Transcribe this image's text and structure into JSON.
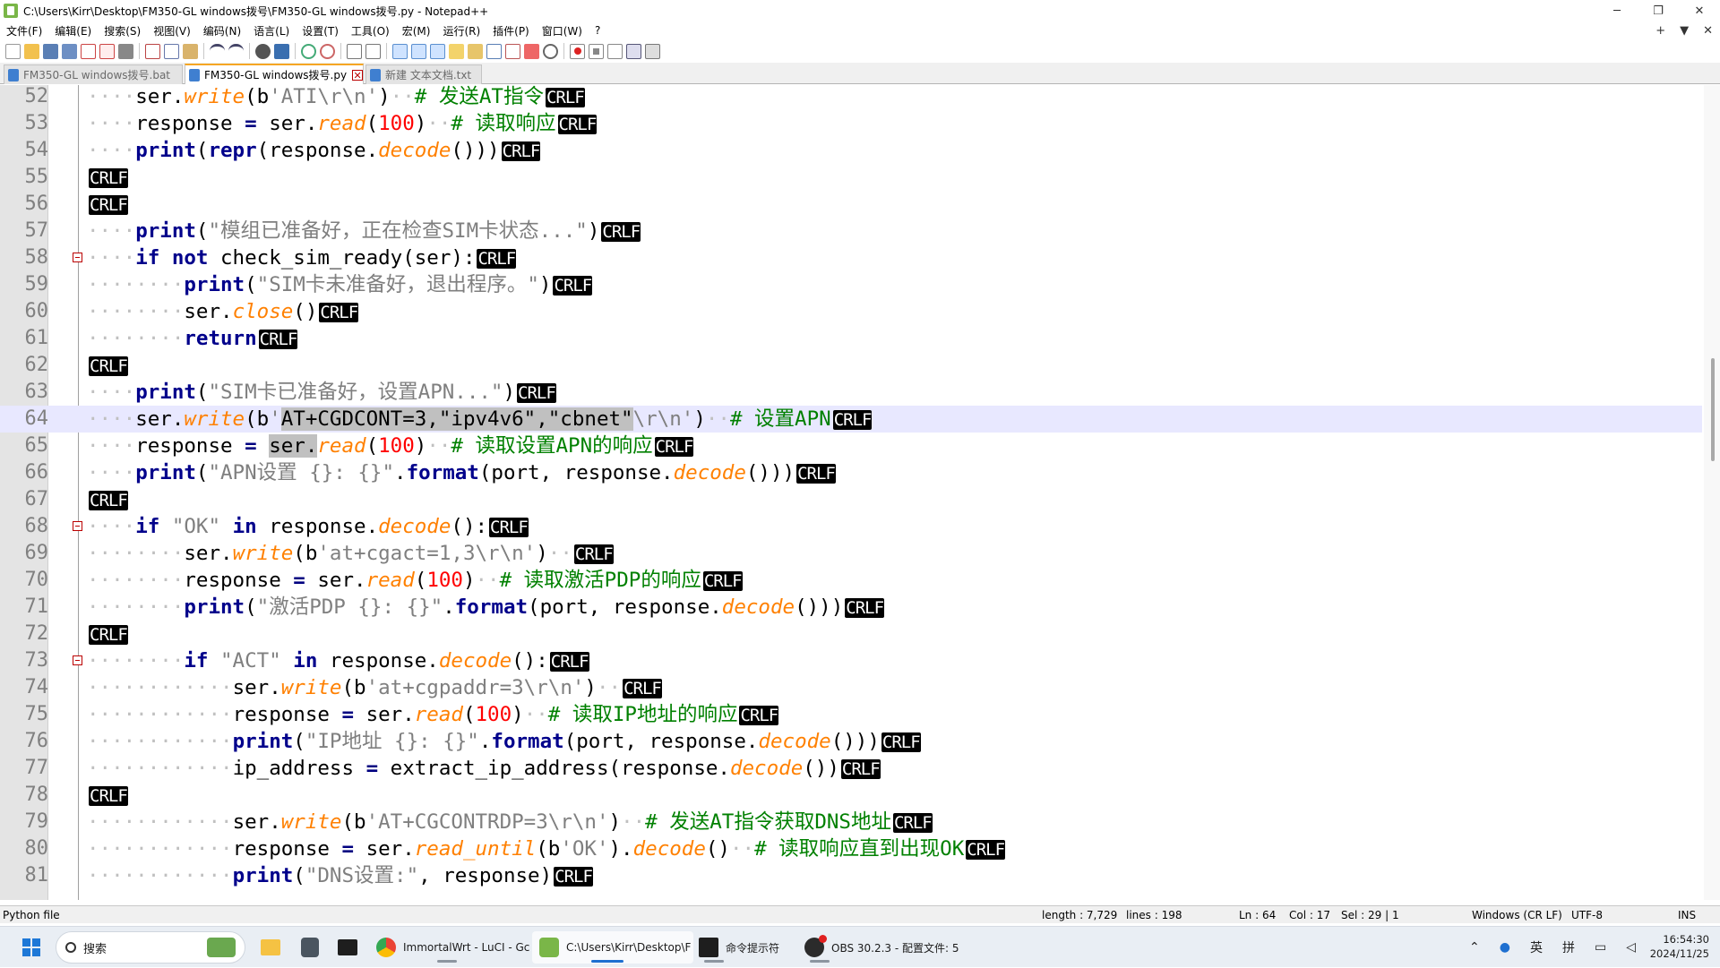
{
  "window": {
    "title": "C:\\Users\\Kirr\\Desktop\\FM350-GL windows拨号\\FM350-GL windows拨号.py - Notepad++",
    "controls": [
      "─",
      "❐",
      "✕"
    ]
  },
  "menu": {
    "items": [
      "文件(F)",
      "编辑(E)",
      "搜索(S)",
      "视图(V)",
      "编码(N)",
      "语言(L)",
      "设置(T)",
      "工具(O)",
      "宏(M)",
      "运行(R)",
      "插件(P)",
      "窗口(W)",
      "?"
    ],
    "right": [
      "+",
      "▼",
      "✕"
    ]
  },
  "tabs": [
    {
      "label": "FM350-GL windows拨号.bat",
      "active": false,
      "color": "#3f7fd0"
    },
    {
      "label": "FM350-GL windows拨号.py",
      "active": true,
      "color": "#3f7fd0"
    },
    {
      "label": "新建 文本文档.txt",
      "active": false,
      "color": "#3f7fd0"
    }
  ],
  "eol_marker": "CRLF",
  "code_lines": [
    {
      "n": "52",
      "ind": 1,
      "t": [
        [
          "fn",
          "ser."
        ],
        [
          "mth",
          "write"
        ],
        [
          "fn",
          "(b"
        ],
        [
          "str",
          "'ATI\\r\\n'"
        ],
        [
          "fn",
          ")"
        ],
        [
          "ws",
          "··"
        ],
        [
          "cmt",
          "# 发送AT指令"
        ]
      ]
    },
    {
      "n": "53",
      "ind": 1,
      "t": [
        [
          "fn",
          "response "
        ],
        [
          "op",
          "="
        ],
        [
          "fn",
          " ser."
        ],
        [
          "mth",
          "read"
        ],
        [
          "fn",
          "("
        ],
        [
          "num",
          "100"
        ],
        [
          "fn",
          ")"
        ],
        [
          "ws",
          "··"
        ],
        [
          "cmt",
          "# 读取响应"
        ]
      ]
    },
    {
      "n": "54",
      "ind": 1,
      "t": [
        [
          "kw",
          "print"
        ],
        [
          "fn",
          "("
        ],
        [
          "kw",
          "repr"
        ],
        [
          "fn",
          "(response."
        ],
        [
          "mth",
          "decode"
        ],
        [
          "fn",
          "()))"
        ]
      ]
    },
    {
      "n": "55",
      "ind": 0,
      "t": []
    },
    {
      "n": "56",
      "ind": 0,
      "t": []
    },
    {
      "n": "57",
      "ind": 1,
      "t": [
        [
          "kw",
          "print"
        ],
        [
          "fn",
          "("
        ],
        [
          "str",
          "\"模组已准备好，正在检查SIM卡状态...\""
        ],
        [
          "fn",
          ")"
        ]
      ]
    },
    {
      "n": "58",
      "ind": 1,
      "fold": true,
      "t": [
        [
          "kw",
          "if"
        ],
        [
          "fn",
          " "
        ],
        [
          "kw",
          "not"
        ],
        [
          "fn",
          " check_sim_ready(ser):"
        ]
      ]
    },
    {
      "n": "59",
      "ind": 2,
      "t": [
        [
          "kw",
          "print"
        ],
        [
          "fn",
          "("
        ],
        [
          "str",
          "\"SIM卡未准备好，退出程序。\""
        ],
        [
          "fn",
          ")"
        ]
      ]
    },
    {
      "n": "60",
      "ind": 2,
      "t": [
        [
          "fn",
          "ser."
        ],
        [
          "mth",
          "close"
        ],
        [
          "fn",
          "()"
        ]
      ]
    },
    {
      "n": "61",
      "ind": 2,
      "t": [
        [
          "kw",
          "return"
        ]
      ]
    },
    {
      "n": "62",
      "ind": 0,
      "t": []
    },
    {
      "n": "63",
      "ind": 1,
      "t": [
        [
          "kw",
          "print"
        ],
        [
          "fn",
          "("
        ],
        [
          "str",
          "\"SIM卡已准备好，设置APN...\""
        ],
        [
          "fn",
          ")"
        ]
      ]
    },
    {
      "n": "64",
      "ind": 1,
      "cur": true,
      "t": [
        [
          "fn",
          "ser."
        ],
        [
          "mth",
          "write"
        ],
        [
          "fn",
          "(b"
        ],
        [
          "str",
          "'"
        ],
        [
          "sel",
          "AT+CGDCONT=3,\"ipv4v6\",\"cbnet\""
        ],
        [
          "str",
          "\\r\\n'"
        ],
        [
          "fn",
          ")"
        ],
        [
          "ws",
          "··"
        ],
        [
          "cmt",
          "# 设置APN"
        ]
      ]
    },
    {
      "n": "65",
      "ind": 1,
      "t": [
        [
          "fn",
          "response "
        ],
        [
          "op",
          "="
        ],
        [
          "fn",
          " "
        ],
        [
          "sel",
          "ser."
        ],
        [
          "mth",
          "read"
        ],
        [
          "fn",
          "("
        ],
        [
          "num",
          "100"
        ],
        [
          "fn",
          ")"
        ],
        [
          "ws",
          "··"
        ],
        [
          "cmt",
          "# 读取设置APN的响应"
        ]
      ]
    },
    {
      "n": "66",
      "ind": 1,
      "t": [
        [
          "kw",
          "print"
        ],
        [
          "fn",
          "("
        ],
        [
          "str",
          "\"APN设置 {}: {}\""
        ],
        [
          "fn",
          "."
        ],
        [
          "kw",
          "format"
        ],
        [
          "fn",
          "(port, response."
        ],
        [
          "mth",
          "decode"
        ],
        [
          "fn",
          "()))"
        ]
      ]
    },
    {
      "n": "67",
      "ind": 0,
      "t": []
    },
    {
      "n": "68",
      "ind": 1,
      "fold": true,
      "t": [
        [
          "kw",
          "if"
        ],
        [
          "fn",
          " "
        ],
        [
          "str",
          "\"OK\""
        ],
        [
          "fn",
          " "
        ],
        [
          "kw",
          "in"
        ],
        [
          "fn",
          " response."
        ],
        [
          "mth",
          "decode"
        ],
        [
          "fn",
          "():"
        ]
      ]
    },
    {
      "n": "69",
      "ind": 2,
      "t": [
        [
          "fn",
          "ser."
        ],
        [
          "mth",
          "write"
        ],
        [
          "fn",
          "(b"
        ],
        [
          "str",
          "'at+cgact=1,3\\r\\n'"
        ],
        [
          "fn",
          ")"
        ],
        [
          "ws",
          "··"
        ]
      ]
    },
    {
      "n": "70",
      "ind": 2,
      "t": [
        [
          "fn",
          "response "
        ],
        [
          "op",
          "="
        ],
        [
          "fn",
          " ser."
        ],
        [
          "mth",
          "read"
        ],
        [
          "fn",
          "("
        ],
        [
          "num",
          "100"
        ],
        [
          "fn",
          ")"
        ],
        [
          "ws",
          "··"
        ],
        [
          "cmt",
          "# 读取激活PDP的响应"
        ]
      ]
    },
    {
      "n": "71",
      "ind": 2,
      "t": [
        [
          "kw",
          "print"
        ],
        [
          "fn",
          "("
        ],
        [
          "str",
          "\"激活PDP {}: {}\""
        ],
        [
          "fn",
          "."
        ],
        [
          "kw",
          "format"
        ],
        [
          "fn",
          "(port, response."
        ],
        [
          "mth",
          "decode"
        ],
        [
          "fn",
          "()))"
        ]
      ]
    },
    {
      "n": "72",
      "ind": 0,
      "t": []
    },
    {
      "n": "73",
      "ind": 2,
      "fold": true,
      "t": [
        [
          "kw",
          "if"
        ],
        [
          "fn",
          " "
        ],
        [
          "str",
          "\"ACT\""
        ],
        [
          "fn",
          " "
        ],
        [
          "kw",
          "in"
        ],
        [
          "fn",
          " response."
        ],
        [
          "mth",
          "decode"
        ],
        [
          "fn",
          "():"
        ]
      ]
    },
    {
      "n": "74",
      "ind": 3,
      "t": [
        [
          "fn",
          "ser."
        ],
        [
          "mth",
          "write"
        ],
        [
          "fn",
          "(b"
        ],
        [
          "str",
          "'at+cgpaddr=3\\r\\n'"
        ],
        [
          "fn",
          ")"
        ],
        [
          "ws",
          "··"
        ]
      ]
    },
    {
      "n": "75",
      "ind": 3,
      "t": [
        [
          "fn",
          "response "
        ],
        [
          "op",
          "="
        ],
        [
          "fn",
          " ser."
        ],
        [
          "mth",
          "read"
        ],
        [
          "fn",
          "("
        ],
        [
          "num",
          "100"
        ],
        [
          "fn",
          ")"
        ],
        [
          "ws",
          "··"
        ],
        [
          "cmt",
          "# 读取IP地址的响应"
        ]
      ]
    },
    {
      "n": "76",
      "ind": 3,
      "t": [
        [
          "kw",
          "print"
        ],
        [
          "fn",
          "("
        ],
        [
          "str",
          "\"IP地址 {}: {}\""
        ],
        [
          "fn",
          "."
        ],
        [
          "kw",
          "format"
        ],
        [
          "fn",
          "(port, response."
        ],
        [
          "mth",
          "decode"
        ],
        [
          "fn",
          "()))"
        ]
      ]
    },
    {
      "n": "77",
      "ind": 3,
      "t": [
        [
          "fn",
          "ip_address "
        ],
        [
          "op",
          "="
        ],
        [
          "fn",
          " extract_ip_address(response."
        ],
        [
          "mth",
          "decode"
        ],
        [
          "fn",
          "())"
        ]
      ]
    },
    {
      "n": "78",
      "ind": 0,
      "t": []
    },
    {
      "n": "79",
      "ind": 3,
      "t": [
        [
          "fn",
          "ser."
        ],
        [
          "mth",
          "write"
        ],
        [
          "fn",
          "(b"
        ],
        [
          "str",
          "'AT+CGCONTRDP=3\\r\\n'"
        ],
        [
          "fn",
          ")"
        ],
        [
          "ws",
          "··"
        ],
        [
          "cmt",
          "# 发送AT指令获取DNS地址"
        ]
      ]
    },
    {
      "n": "80",
      "ind": 3,
      "t": [
        [
          "fn",
          "response "
        ],
        [
          "op",
          "="
        ],
        [
          "fn",
          " ser."
        ],
        [
          "mth",
          "read_until"
        ],
        [
          "fn",
          "(b"
        ],
        [
          "str",
          "'OK'"
        ],
        [
          "fn",
          ")."
        ],
        [
          "mth",
          "decode"
        ],
        [
          "fn",
          "()"
        ],
        [
          "ws",
          "··"
        ],
        [
          "cmt",
          "# 读取响应直到出现OK"
        ]
      ]
    },
    {
      "n": "81",
      "ind": 3,
      "t": [
        [
          "kw",
          "print"
        ],
        [
          "fn",
          "("
        ],
        [
          "str",
          "\"DNS设置:\""
        ],
        [
          "fn",
          ", response)"
        ]
      ]
    }
  ],
  "status": {
    "file_type": "Python file",
    "length": "length : 7,729",
    "lines": "lines : 198",
    "ln": "Ln : 64",
    "col": "Col : 17",
    "sel": "Sel : 29 | 1",
    "eol": "Windows (CR LF)",
    "encoding": "UTF-8",
    "mode": "INS"
  },
  "taskbar": {
    "search_label": "搜索",
    "apps": [
      {
        "label": "ImmortalWrt - LuCI - Gc",
        "icon": "chrome-icon",
        "color": "#34a853"
      },
      {
        "label": "C:\\Users\\Kirr\\Desktop\\F",
        "icon": "notepadpp-icon",
        "color": "#7ab648"
      },
      {
        "label": "命令提示符",
        "icon": "cmd-icon",
        "color": "#1e1e1e"
      },
      {
        "label": "OBS 30.2.3 - 配置文件: 5",
        "icon": "obs-icon",
        "color": "#2b2b2b"
      }
    ],
    "tray": {
      "lang1": "英",
      "lang2": "拼",
      "time": "16:54:30",
      "date": "2024/11/25"
    }
  }
}
